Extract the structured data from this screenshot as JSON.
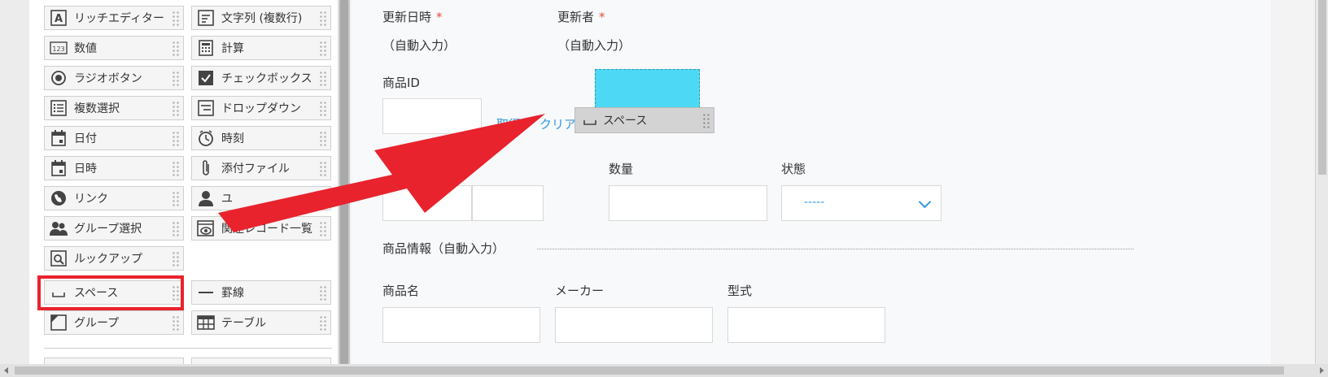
{
  "palette": {
    "items": [
      {
        "id": "rich-editor",
        "label": "リッチエディター",
        "icon": "rich-editor-icon"
      },
      {
        "id": "multiline-text",
        "label": "文字列 (複数行)",
        "icon": "multiline-text-icon"
      },
      {
        "id": "number",
        "label": "数値",
        "icon": "number-icon"
      },
      {
        "id": "calc",
        "label": "計算",
        "icon": "calculator-icon"
      },
      {
        "id": "radio",
        "label": "ラジオボタン",
        "icon": "radio-icon"
      },
      {
        "id": "checkbox",
        "label": "チェックボックス",
        "icon": "checkbox-icon"
      },
      {
        "id": "multi-select",
        "label": "複数選択",
        "icon": "multi-select-icon"
      },
      {
        "id": "dropdown",
        "label": "ドロップダウン",
        "icon": "dropdown-icon"
      },
      {
        "id": "date",
        "label": "日付",
        "icon": "calendar-icon"
      },
      {
        "id": "time",
        "label": "時刻",
        "icon": "clock-icon"
      },
      {
        "id": "datetime",
        "label": "日時",
        "icon": "calendar-icon"
      },
      {
        "id": "attachment",
        "label": "添付ファイル",
        "icon": "paperclip-icon"
      },
      {
        "id": "link",
        "label": "リンク",
        "icon": "globe-icon"
      },
      {
        "id": "user-select",
        "label": "ユ",
        "icon": "user-icon"
      },
      {
        "id": "group-select",
        "label": "グループ選択",
        "icon": "group-icon"
      },
      {
        "id": "related-records",
        "label": "関連レコード一覧",
        "icon": "related-records-icon"
      },
      {
        "id": "lookup",
        "label": "ルックアップ",
        "icon": "lookup-icon"
      },
      {
        "id": "space",
        "label": "スペース",
        "icon": "space-icon"
      },
      {
        "id": "border",
        "label": "罫線",
        "icon": "line-icon"
      },
      {
        "id": "group",
        "label": "グループ",
        "icon": "group-fold-icon"
      },
      {
        "id": "table",
        "label": "テーブル",
        "icon": "table-icon"
      }
    ]
  },
  "form": {
    "updated_at": {
      "label": "更新日時",
      "required_mark": "*",
      "value": "（自動入力）"
    },
    "updated_by": {
      "label": "更新者",
      "required_mark": "*",
      "value": "（自動入力）"
    },
    "product_id": {
      "label": "商品ID",
      "get_link": "取得",
      "clear_link": "クリア"
    },
    "quantity": {
      "label": "数量"
    },
    "status": {
      "label": "状態",
      "placeholder": "-----"
    },
    "product_info": {
      "label": "商品情報（自動入力）"
    },
    "product_name": {
      "label": "商品名"
    },
    "maker": {
      "label": "メーカー"
    },
    "model": {
      "label": "型式"
    }
  },
  "drag_ghost": {
    "label": "スペース",
    "icon": "space-icon"
  },
  "colors": {
    "accent": "#3498db",
    "required": "#e74c3c",
    "annotation": "#e8232d",
    "drop_target": "#4dd9f5"
  }
}
